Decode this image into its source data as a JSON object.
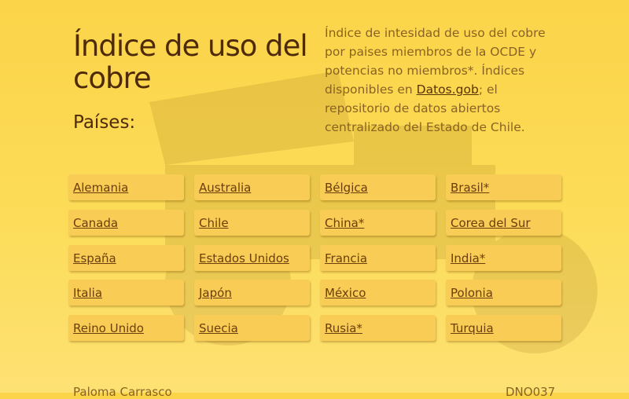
{
  "header": {
    "title": "Índice de uso del cobre",
    "subtitle": "Países:"
  },
  "description": {
    "text_before": "Índice de intesidad de uso del cobre por paises miembros de la OCDE y potencias no miembros*. Índices disponibles en ",
    "link": "Datos.gob",
    "text_after": "; el repositorio de datos abiertos centralizado del Estado de Chile."
  },
  "countries": [
    "Alemania",
    "Australia",
    "Bélgica",
    "Brasil*",
    "Canada",
    "Chile",
    "China*",
    "Corea del Sur",
    "España",
    "Estados Unidos",
    "Francia",
    "India*",
    "Italia",
    "Japón",
    "México",
    "Polonia",
    "Reino Unido",
    "Suecia",
    "Rusia*",
    "Turquia"
  ],
  "footer": {
    "author": "Paloma Carrasco",
    "code": "DNO037"
  }
}
